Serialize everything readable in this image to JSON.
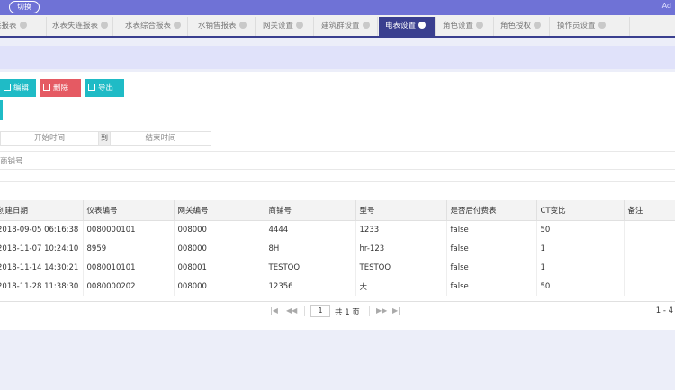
{
  "topbar": {
    "switch_label": "切换",
    "user": "Ad"
  },
  "tabs": [
    {
      "label": "耗报表"
    },
    {
      "label": "水表失连报表"
    },
    {
      "label": "水表综合报表"
    },
    {
      "label": "水销售报表"
    },
    {
      "label": "网关设置"
    },
    {
      "label": "建筑群设置"
    },
    {
      "label": "电表设置",
      "active": true
    },
    {
      "label": "角色设置"
    },
    {
      "label": "角色授权"
    },
    {
      "label": "操作员设置"
    }
  ],
  "toolbar": {
    "edit_label": "编辑",
    "delete_label": "删除",
    "export_label": "导出"
  },
  "filters": {
    "start_placeholder": "开始时间",
    "to_label": "到",
    "end_placeholder": "结束时间",
    "shop_placeholder": "商铺号"
  },
  "table": {
    "columns": [
      "创建日期",
      "仪表编号",
      "网关编号",
      "商铺号",
      "型号",
      "是否后付费表",
      "CT变比",
      "备注"
    ],
    "rows": [
      [
        "2018-09-05 06:16:38",
        "0080000101",
        "008000",
        "4444",
        "1233",
        "false",
        "50",
        ""
      ],
      [
        "2018-11-07 10:24:10",
        "8959",
        "008000",
        "8H",
        "hr-123",
        "false",
        "1",
        ""
      ],
      [
        "2018-11-14 14:30:21",
        "0080010101",
        "008001",
        "TESTQQ",
        "TESTQQ",
        "false",
        "1",
        ""
      ],
      [
        "2018-11-28 11:38:30",
        "0080000202",
        "008000",
        "12356",
        "大",
        "false",
        "50",
        ""
      ]
    ]
  },
  "pager": {
    "page": "1",
    "total": "共 1 页",
    "range": "1 - 4"
  }
}
